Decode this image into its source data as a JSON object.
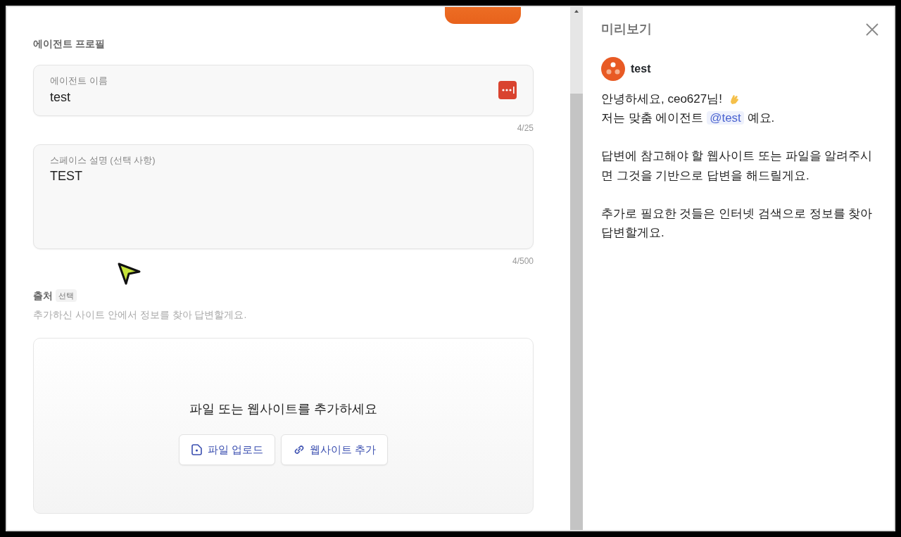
{
  "editor": {
    "section_title": "에이전트 프로필",
    "name_field": {
      "label": "에이전트 이름",
      "value": "test",
      "counter": "4/25"
    },
    "description_field": {
      "label": "스페이스 설명 (선택 사항)",
      "value": "TEST",
      "counter": "4/500"
    },
    "sources": {
      "title": "출처",
      "tag": "선택",
      "hint": "추가하신 사이트 안에서 정보를 찾아 답변할게요.",
      "dropzone": {
        "title": "파일 또는 웹사이트를 추가하세요",
        "buttons": [
          {
            "kind": "upload",
            "label": "파일 업로드"
          },
          {
            "kind": "link",
            "label": "웹사이트 추가"
          }
        ]
      }
    }
  },
  "preview": {
    "title": "미리보기",
    "agent_name": "test",
    "greeting": "안녕하세요, ceo627님!",
    "intro_before": "저는 맞춤 에이전트",
    "mention": "@test",
    "intro_after": "예요.",
    "paragraphs": [
      "답변에 참고해야 할 웹사이트 또는 파일을 알려주시면 그것을 기반으로 답변을 해드릴게요.",
      "추가로 필요한 것들은 인터넷 검색으로 정보를 찾아 답변할게요."
    ]
  }
}
